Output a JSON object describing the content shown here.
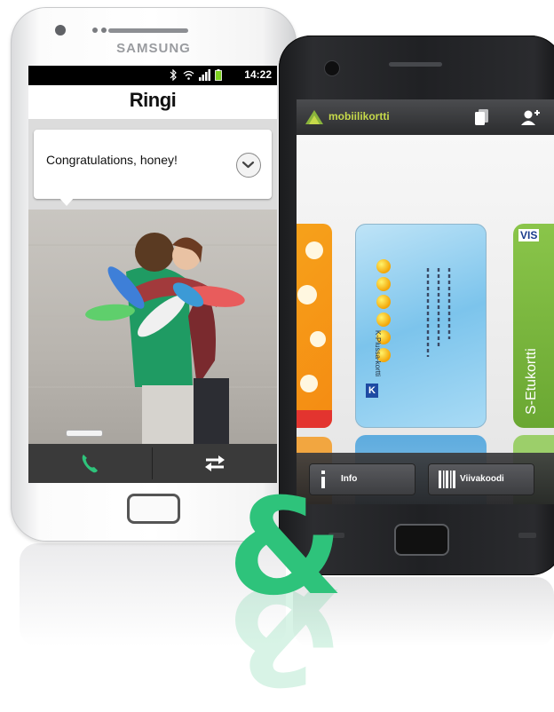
{
  "white_phone": {
    "brand": "SAMSUNG",
    "status_time": "14:22",
    "app_title": "Ringi",
    "message": "Congratulations, honey!",
    "icons": {
      "expand": "chevron-down-icon",
      "call": "phone-icon",
      "switch": "arrows-swap-icon",
      "bluetooth": "bluetooth-icon",
      "wifi": "wifi-icon",
      "signal": "signal-icon",
      "battery": "battery-icon"
    }
  },
  "black_phone": {
    "app_title": "mobiilikortti",
    "cards": {
      "center_brand": "K",
      "center_label": "K-Plussa-kortti",
      "right_brand": "VIS",
      "right_name": "S-Etukortti"
    },
    "buttons": {
      "info_label": "Info",
      "barcode_label": "Viivakoodi"
    },
    "icons": {
      "cards": "cards-icon",
      "add_user": "add-user-icon",
      "info": "info-icon",
      "barcode": "barcode-icon"
    }
  },
  "decor": {
    "ampersand": "&",
    "ampersand_color": "#2ec37b",
    "mobiilikortti_accent": "#c6d94a",
    "call_color": "#2ec37b"
  }
}
